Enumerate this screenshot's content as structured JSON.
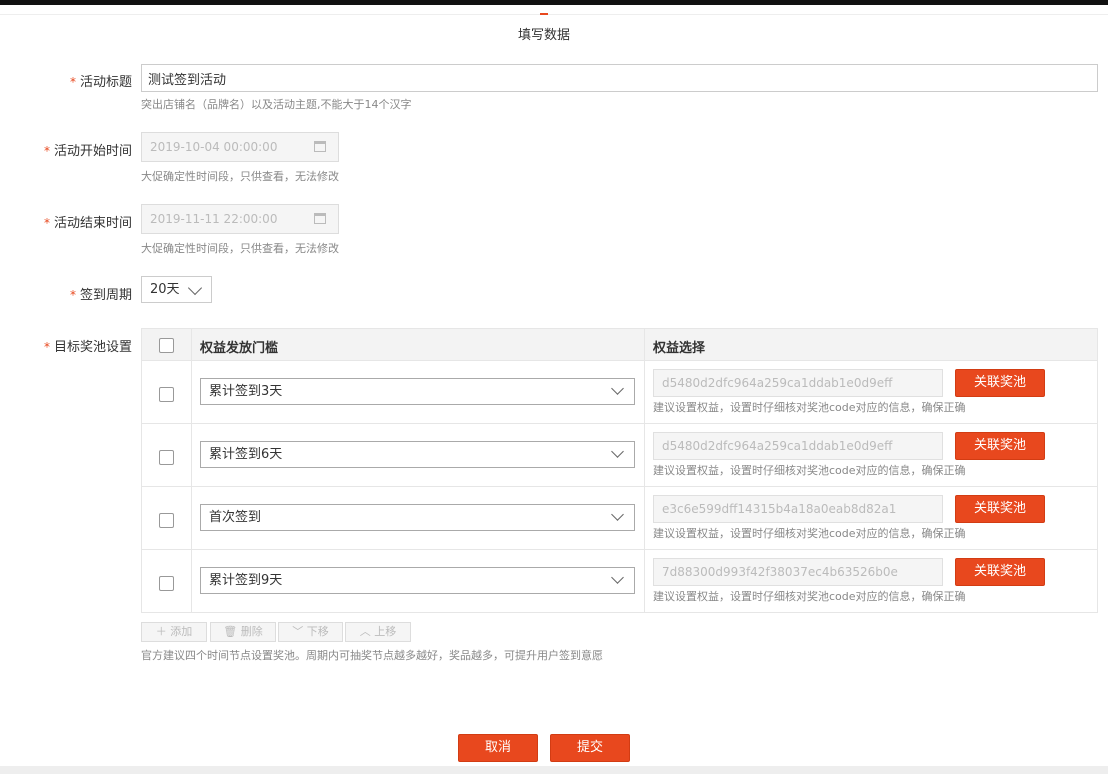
{
  "header": {
    "title": "填写数据"
  },
  "form": {
    "title": {
      "label": "活动标题",
      "value": "测试签到活动",
      "hint": "突出店铺名（品牌名）以及活动主题,不能大于14个汉字"
    },
    "start_time": {
      "label": "活动开始时间",
      "value": "2019-10-04 00:00:00",
      "hint": "大促确定性时间段，只供查看，无法修改"
    },
    "end_time": {
      "label": "活动结束时间",
      "value": "2019-11-11 22:00:00",
      "hint": "大促确定性时间段，只供查看，无法修改"
    },
    "cycle": {
      "label": "签到周期",
      "value": "20天"
    },
    "pool": {
      "label": "目标奖池设置",
      "col_threshold": "权益发放门槛",
      "col_benefit": "权益选择",
      "link_label": "关联奖池",
      "row_hint": "建议设置权益，设置时仔细核对奖池code对应的信息，确保正确",
      "rows": [
        {
          "threshold": "累计签到3天",
          "code": "d5480d2dfc964a259ca1ddab1e0d9eff"
        },
        {
          "threshold": "累计签到6天",
          "code": "d5480d2dfc964a259ca1ddab1e0d9eff"
        },
        {
          "threshold": "首次签到",
          "code": "e3c6e599dff14315b4a18a0eab8d82a1"
        },
        {
          "threshold": "累计签到9天",
          "code": "7d88300d993f42f38037ec4b63526b0e"
        }
      ]
    },
    "toolbar": {
      "add": "添加",
      "delete": "删除",
      "down": "下移",
      "up": "上移"
    },
    "footer_hint": "官方建议四个时间节点设置奖池。周期内可抽奖节点越多越好，奖品越多，可提升用户签到意愿"
  },
  "actions": {
    "cancel": "取消",
    "submit": "提交"
  },
  "colors": {
    "accent": "#e8481e",
    "required": "#e8481e"
  }
}
